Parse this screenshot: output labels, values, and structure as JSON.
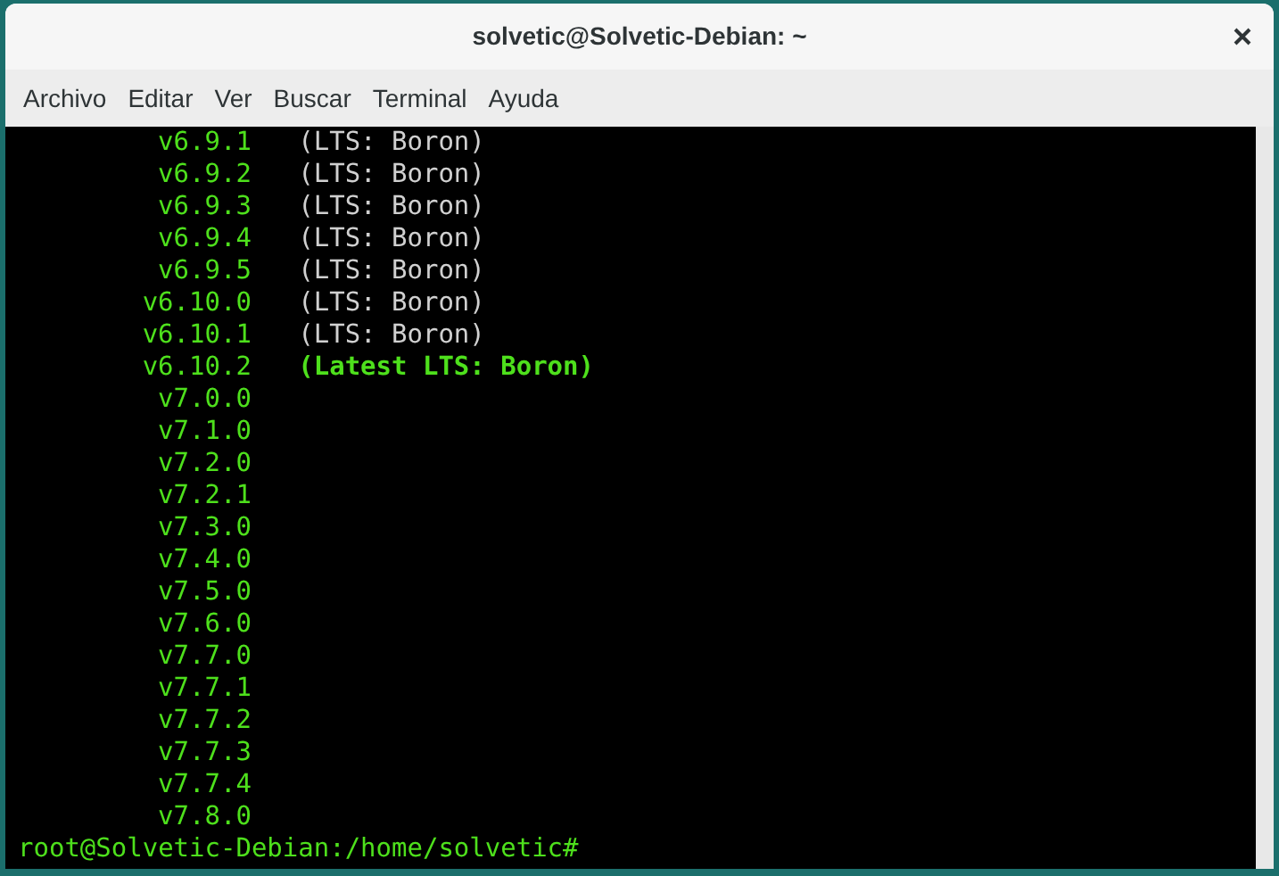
{
  "window": {
    "title": "solvetic@Solvetic-Debian: ~"
  },
  "menu": [
    "Archivo",
    "Editar",
    "Ver",
    "Buscar",
    "Terminal",
    "Ayuda"
  ],
  "terminal": {
    "lines": [
      {
        "version": "v6.9.1",
        "note": "(LTS: Boron)",
        "kind": "lts"
      },
      {
        "version": "v6.9.2",
        "note": "(LTS: Boron)",
        "kind": "lts"
      },
      {
        "version": "v6.9.3",
        "note": "(LTS: Boron)",
        "kind": "lts"
      },
      {
        "version": "v6.9.4",
        "note": "(LTS: Boron)",
        "kind": "lts"
      },
      {
        "version": "v6.9.5",
        "note": "(LTS: Boron)",
        "kind": "lts"
      },
      {
        "version": "v6.10.0",
        "note": "(LTS: Boron)",
        "kind": "lts"
      },
      {
        "version": "v6.10.1",
        "note": "(LTS: Boron)",
        "kind": "lts"
      },
      {
        "version": "v6.10.2",
        "note": "(Latest LTS: Boron)",
        "kind": "latest"
      },
      {
        "version": "v7.0.0"
      },
      {
        "version": "v7.1.0"
      },
      {
        "version": "v7.2.0"
      },
      {
        "version": "v7.2.1"
      },
      {
        "version": "v7.3.0"
      },
      {
        "version": "v7.4.0"
      },
      {
        "version": "v7.5.0"
      },
      {
        "version": "v7.6.0"
      },
      {
        "version": "v7.7.0"
      },
      {
        "version": "v7.7.1"
      },
      {
        "version": "v7.7.2"
      },
      {
        "version": "v7.7.3"
      },
      {
        "version": "v7.7.4"
      },
      {
        "version": "v7.8.0"
      }
    ],
    "prompt": "root@Solvetic-Debian:/home/solvetic#"
  }
}
